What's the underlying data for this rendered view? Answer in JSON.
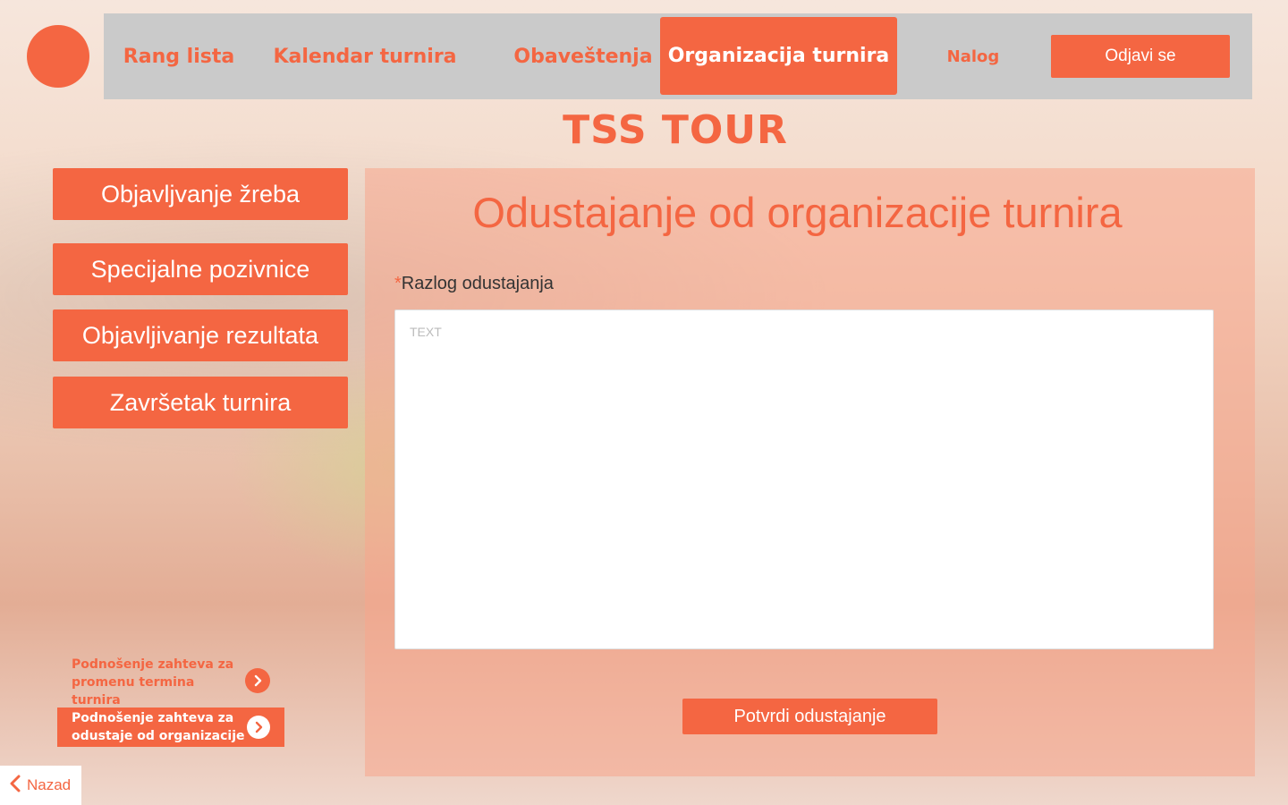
{
  "nav": {
    "items": [
      {
        "label": "Rang lista"
      },
      {
        "label": "Kalendar turnira"
      },
      {
        "label": "Obaveštenja"
      },
      {
        "label": "Organizacija turnira"
      },
      {
        "label": "Nalog"
      }
    ],
    "logout_label": "Odjavi se"
  },
  "brand": {
    "title": "TSS TOUR"
  },
  "sidebar": {
    "items": [
      {
        "label": "Objavljvanje žreba"
      },
      {
        "label": "Specijalne pozivnice"
      },
      {
        "label": "Objavljivanje rezultata"
      },
      {
        "label": "Završetak turnira"
      }
    ],
    "requests": [
      {
        "label": "Podnošenje zahteva za promenu termina turnira"
      },
      {
        "label": "Podnošenje zahteva za odustaje od organizacije"
      }
    ],
    "back_label": "Nazad"
  },
  "main": {
    "title": "Odustajanje od organizacije turnira",
    "field": {
      "required_mark": "*",
      "label": "Razlog odustajanja",
      "placeholder": "TEXT",
      "value": ""
    },
    "confirm_label": "Potvrdi odustajanje"
  },
  "colors": {
    "accent": "#f46642",
    "nav_bg": "#cacaca",
    "panel_bg": "#f8a58c"
  }
}
